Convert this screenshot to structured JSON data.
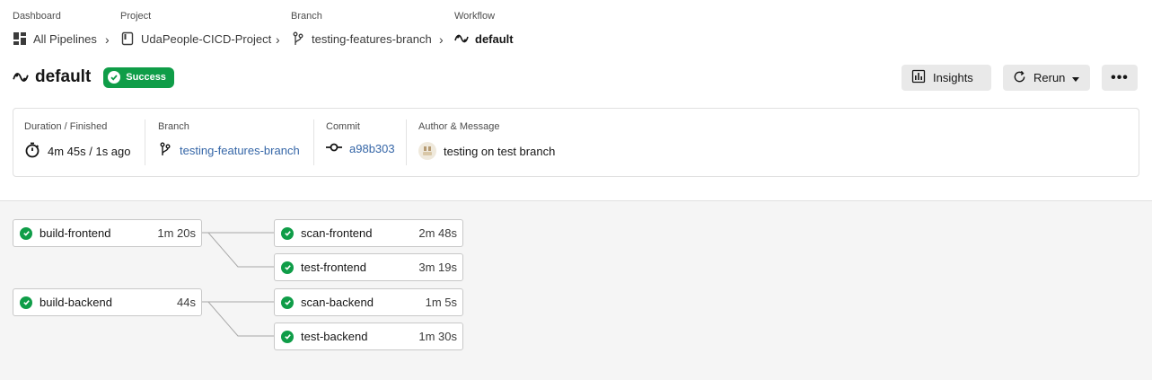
{
  "breadcrumbs": [
    {
      "caption": "Dashboard",
      "label": "All Pipelines",
      "icon": "dashboard-icon"
    },
    {
      "caption": "Project",
      "label": "UdaPeople-CICD-Project",
      "icon": "project-icon"
    },
    {
      "caption": "Branch",
      "label": "testing-features-branch",
      "icon": "branch-icon"
    },
    {
      "caption": "Workflow",
      "label": "default",
      "icon": "workflow-icon"
    }
  ],
  "workflow": {
    "title": "default",
    "status": "Success"
  },
  "actions": {
    "insights": "Insights",
    "rerun": "Rerun",
    "more": "•••"
  },
  "summary": {
    "duration": {
      "caption": "Duration / Finished",
      "value": "4m 45s / 1s ago"
    },
    "branch": {
      "caption": "Branch",
      "value": "testing-features-branch"
    },
    "commit": {
      "caption": "Commit",
      "value": "a98b303"
    },
    "author": {
      "caption": "Author & Message",
      "value": "testing on test branch"
    }
  },
  "jobs": [
    {
      "name": "build-frontend",
      "duration": "1m 20s",
      "status": "success"
    },
    {
      "name": "scan-frontend",
      "duration": "2m 48s",
      "status": "success"
    },
    {
      "name": "test-frontend",
      "duration": "3m 19s",
      "status": "success"
    },
    {
      "name": "build-backend",
      "duration": "44s",
      "status": "success"
    },
    {
      "name": "scan-backend",
      "duration": "1m 5s",
      "status": "success"
    },
    {
      "name": "test-backend",
      "duration": "1m 30s",
      "status": "success"
    }
  ],
  "colors": {
    "success": "#0f9d48",
    "link": "#3566a7"
  }
}
